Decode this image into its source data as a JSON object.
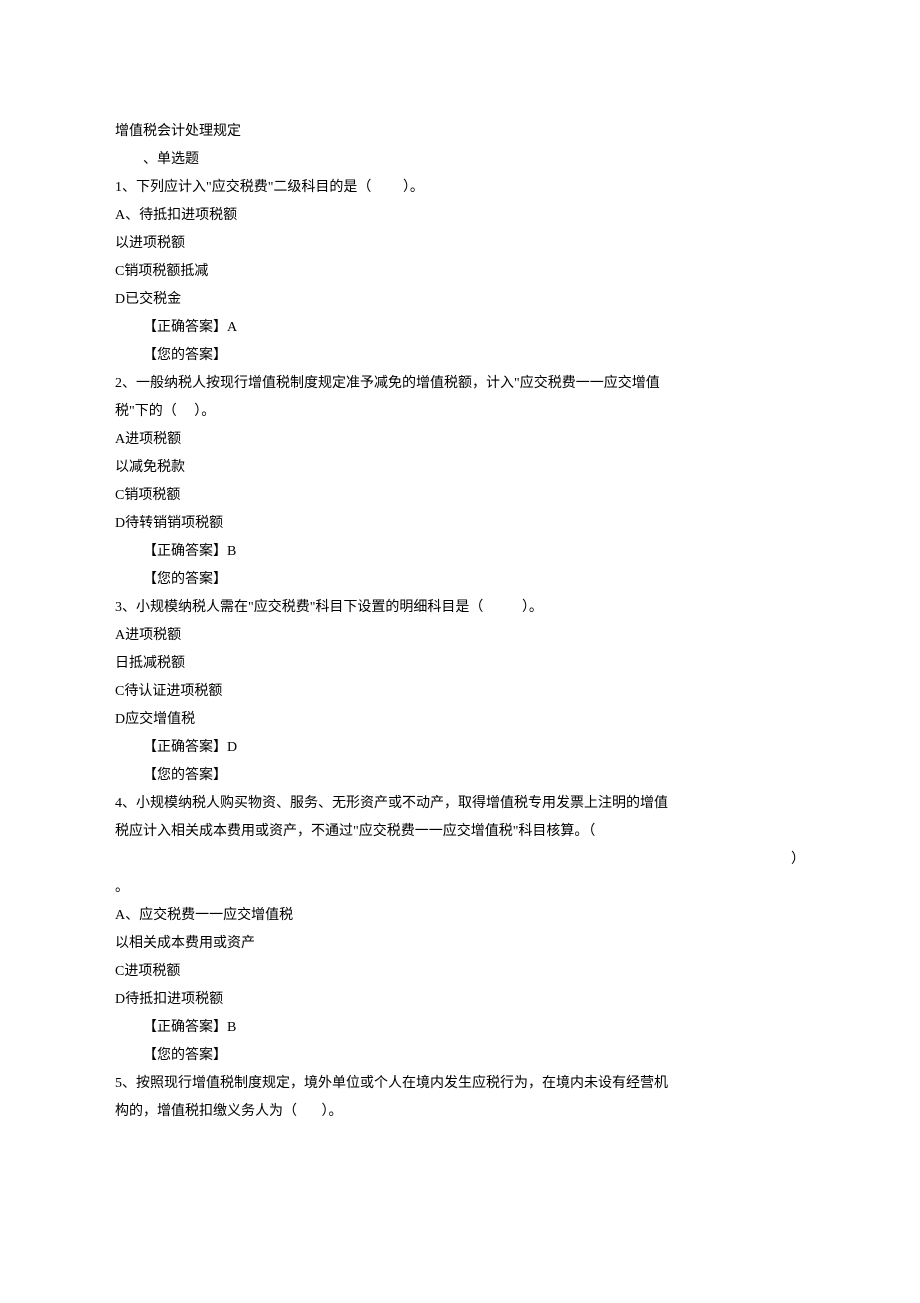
{
  "title": "增值税会计处理规定",
  "sectionHeading": "、单选题",
  "questions": [
    {
      "number": "1",
      "stemParts": [
        "、下列应计入\"应交税费\"二级科目的是（",
        "）。"
      ],
      "options": [
        "A、待抵扣进项税额",
        "以进项税额",
        "C销项税额抵减",
        "D已交税金"
      ],
      "correct": "【正确答案】A",
      "yourAnswer": "【您的答案】"
    },
    {
      "number": "2",
      "stemParts": [
        "、一般纳税人按现行增值税制度规定准予减免的增值税额，计入\"应交税费一一应交增值"
      ],
      "stemLine2Parts": [
        "税\"下的（",
        "）。"
      ],
      "options": [
        "A进项税额",
        "以减免税款",
        "C销项税额",
        "D待转销销项税额"
      ],
      "correct": "【正确答案】B",
      "yourAnswer": "【您的答案】"
    },
    {
      "number": "3",
      "stemParts": [
        "、小规模纳税人需在\"应交税费\"科目下设置的明细科目是（",
        "）。"
      ],
      "options": [
        "A进项税额",
        "日抵减税额",
        "C待认证进项税额",
        "D应交增值税"
      ],
      "correct": "【正确答案】D",
      "yourAnswer": "【您的答案】"
    },
    {
      "number": "4",
      "stemParts": [
        "、小规模纳税人购买物资、服务、无形资产或不动产，取得增值税专用发票上注明的增值"
      ],
      "stemLine2Parts": [
        "税应计入相关成本费用或资产，不通过\"应交税费一一应交增值税\"科目核算。（"
      ],
      "trailing": "）",
      "stemLine3": "。",
      "options": [
        "A、应交税费一一应交增值税",
        "以相关成本费用或资产",
        "C进项税额",
        "D待抵扣进项税额"
      ],
      "correct": "【正确答案】B",
      "yourAnswer": "【您的答案】"
    },
    {
      "number": "5",
      "stemParts": [
        "、按照现行增值税制度规定，境外单位或个人在境内发生应税行为，在境内未设有经营机"
      ],
      "stemLine2Parts": [
        "构的，增值税扣缴义务人为（",
        "）。"
      ]
    }
  ]
}
